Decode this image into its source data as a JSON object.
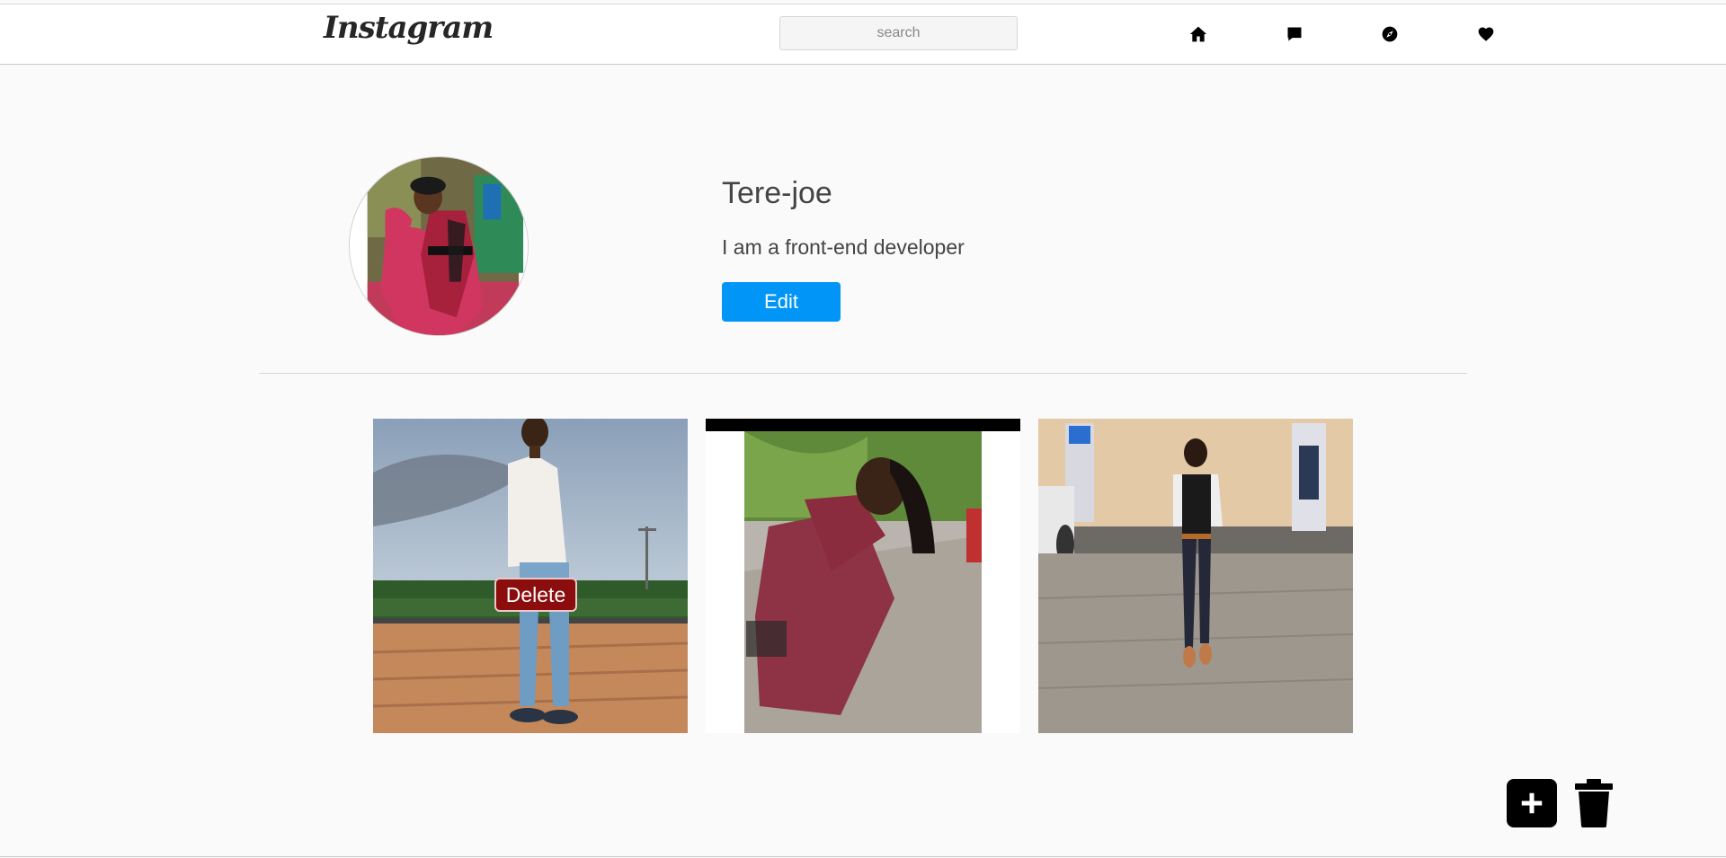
{
  "header": {
    "logo_text": "Instagram",
    "search": {
      "placeholder": "search",
      "value": ""
    },
    "icons": [
      "home-icon",
      "chat-icon",
      "compass-icon",
      "heart-icon"
    ]
  },
  "profile": {
    "username": "Tere-joe",
    "bio": "I am a front-end developer",
    "edit_label": "Edit"
  },
  "posts": [
    {
      "name": "post-1",
      "delete_label": "Delete"
    },
    {
      "name": "post-2"
    },
    {
      "name": "post-3"
    }
  ],
  "actions": {
    "add_icon": "plus-square-icon",
    "delete_icon": "trash-icon"
  },
  "colors": {
    "accent": "#0095f6",
    "delete": "#8b0d0d",
    "background": "#fafafa"
  }
}
